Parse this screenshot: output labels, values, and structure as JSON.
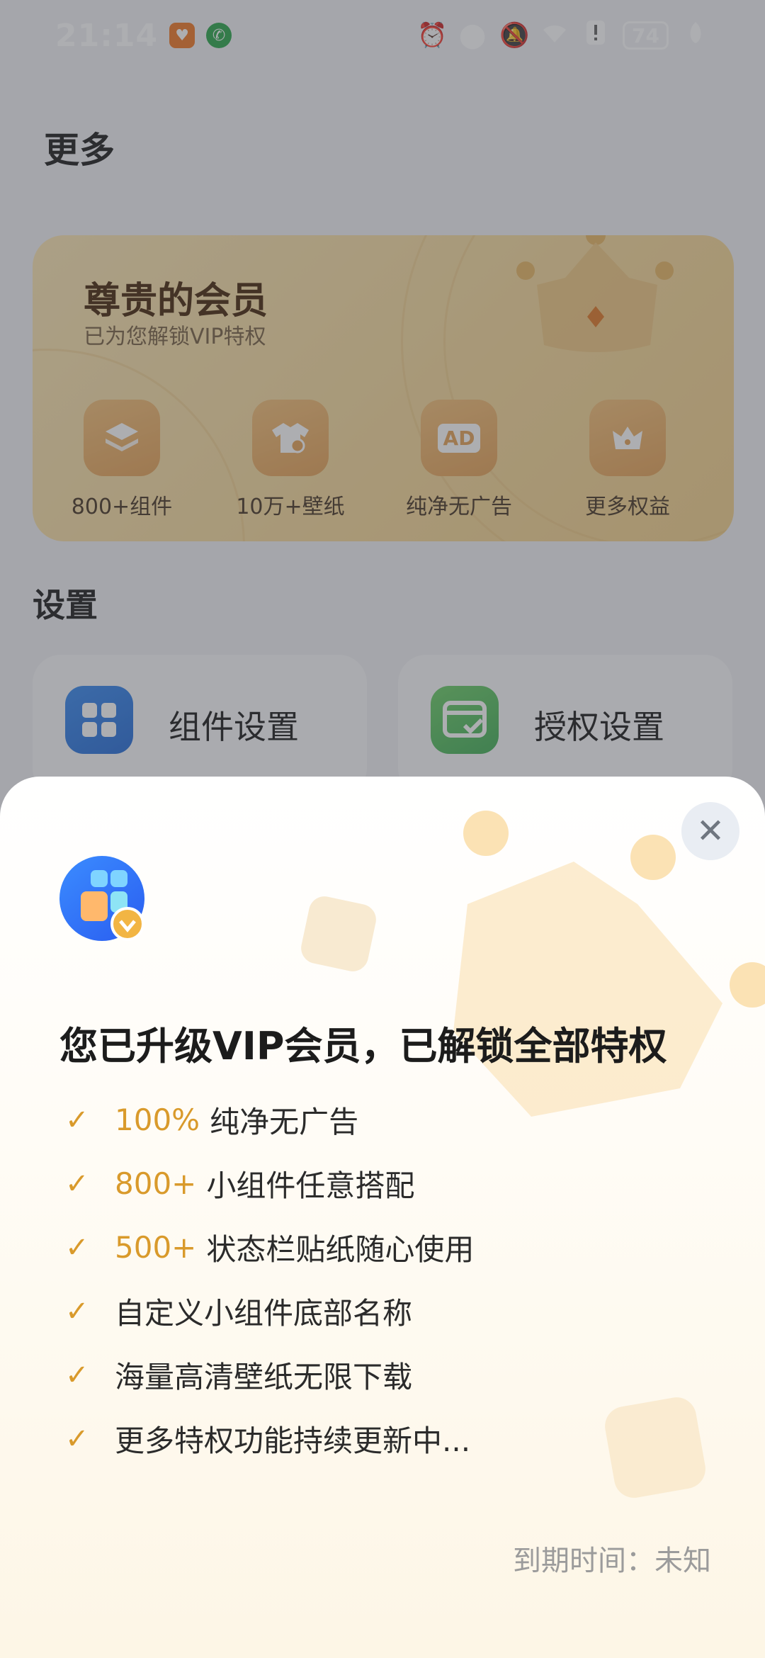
{
  "status_bar": {
    "time": "21:14",
    "battery": "74",
    "icons": [
      "alarm-icon",
      "location-icon",
      "mute-icon",
      "wifi-icon",
      "alert-icon",
      "leaf-icon"
    ]
  },
  "page": {
    "title": "更多",
    "vip_card": {
      "title": "尊贵的会员",
      "subtitle": "已为您解锁VIP特权",
      "benefits": [
        {
          "label": "800+组件",
          "icon": "layers-icon"
        },
        {
          "label": "10万+壁纸",
          "icon": "shirt-icon"
        },
        {
          "label": "纯净无广告",
          "icon": "ad-icon",
          "icon_text": "AD"
        },
        {
          "label": "更多权益",
          "icon": "crown-icon"
        }
      ]
    },
    "settings": {
      "title": "设置",
      "items": [
        {
          "label": "组件设置",
          "icon": "widget-grid-icon"
        },
        {
          "label": "授权设置",
          "icon": "auth-window-icon"
        }
      ]
    }
  },
  "sheet": {
    "headline": "您已升级VIP会员，已解锁全部特权",
    "features": [
      {
        "highlight": "100%",
        "text": "纯净无广告"
      },
      {
        "highlight": "800+",
        "text": "小组件任意搭配"
      },
      {
        "highlight": "500+",
        "text": "状态栏贴纸随心使用"
      },
      {
        "highlight": "",
        "text": "自定义小组件底部名称"
      },
      {
        "highlight": "",
        "text": "海量高清壁纸无限下载"
      },
      {
        "highlight": "",
        "text": "更多特权功能持续更新中..."
      }
    ],
    "expire": "到期时间：未知",
    "check_glyph": "✓",
    "close_glyph": "✕"
  },
  "colors": {
    "accent": "#d99a2b",
    "vip_gold": "#f6d99b",
    "dim_overlay": "#3c3e44"
  }
}
